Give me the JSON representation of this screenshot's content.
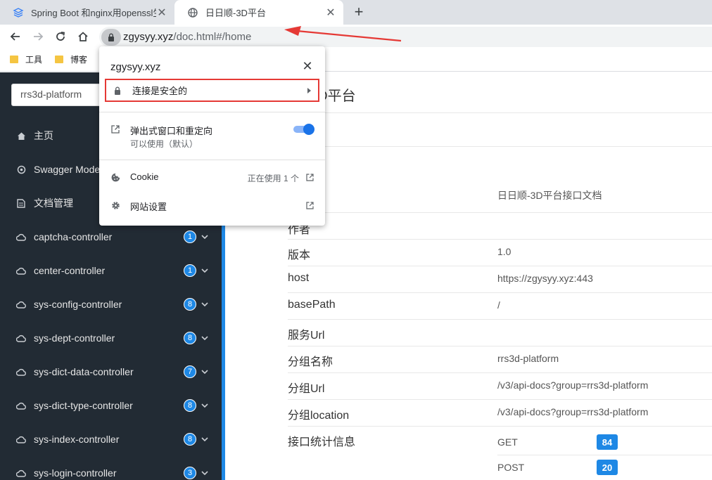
{
  "browser": {
    "tabs": [
      {
        "title": "Spring Boot 和nginx用openssl生",
        "active": false
      },
      {
        "title": "日日顺-3D平台",
        "active": true
      }
    ],
    "new_tab": "+",
    "url_host": "zgysyy.xyz",
    "url_path": "/doc.html#/home",
    "bookmarks": [
      "工具",
      "博客"
    ]
  },
  "popup": {
    "host": "zgysyy.xyz",
    "close": "✕",
    "secure_label": "连接是安全的",
    "popups_label": "弹出式窗口和重定向",
    "popups_sub": "可以使用（默认）",
    "popups_enabled": true,
    "cookie_label": "Cookie",
    "cookie_status": "正在使用 1 个",
    "site_settings_label": "网站设置"
  },
  "sidebar": {
    "group_select": "rrs3d-platform",
    "items": [
      {
        "label": "主页",
        "icon": "home-icon"
      },
      {
        "label": "Swagger Models",
        "icon": "models-icon"
      },
      {
        "label": "文档管理",
        "icon": "document-icon"
      },
      {
        "label": "captcha-controller",
        "badge": "1",
        "icon": "cloud-icon"
      },
      {
        "label": "center-controller",
        "badge": "1",
        "icon": "cloud-icon"
      },
      {
        "label": "sys-config-controller",
        "badge": "8",
        "icon": "cloud-icon"
      },
      {
        "label": "sys-dept-controller",
        "badge": "8",
        "icon": "cloud-icon"
      },
      {
        "label": "sys-dict-data-controller",
        "badge": "7",
        "icon": "cloud-icon"
      },
      {
        "label": "sys-dict-type-controller",
        "badge": "8",
        "icon": "cloud-icon"
      },
      {
        "label": "sys-index-controller",
        "badge": "8",
        "icon": "cloud-icon"
      },
      {
        "label": "sys-login-controller",
        "badge": "3",
        "icon": "cloud-icon"
      }
    ]
  },
  "main": {
    "title": "日日顺-3D平台",
    "title_visible": "3D平台",
    "info": [
      {
        "key": "",
        "value": "日日顺-3D平台接口文档"
      },
      {
        "key": "作者",
        "value": ""
      },
      {
        "key": "版本",
        "value": "1.0"
      },
      {
        "key": "host",
        "value": "https://zgysyy.xyz:443"
      },
      {
        "key": "basePath",
        "value": "/"
      },
      {
        "key": "服务Url",
        "value": ""
      },
      {
        "key": "分组名称",
        "value": "rrs3d-platform"
      },
      {
        "key": "分组Url",
        "value": "/v3/api-docs?group=rrs3d-platform"
      },
      {
        "key": "分组location",
        "value": "/v3/api-docs?group=rrs3d-platform"
      },
      {
        "key": "接口统计信息",
        "value": ""
      }
    ],
    "methods": [
      {
        "name": "GET",
        "count": "84"
      },
      {
        "name": "POST",
        "count": "20"
      }
    ]
  },
  "colors": {
    "sidebar_bg": "#222b34",
    "accent": "#1e88e5",
    "highlight_border": "#e53935",
    "annotation_arrow": "#e53935"
  }
}
